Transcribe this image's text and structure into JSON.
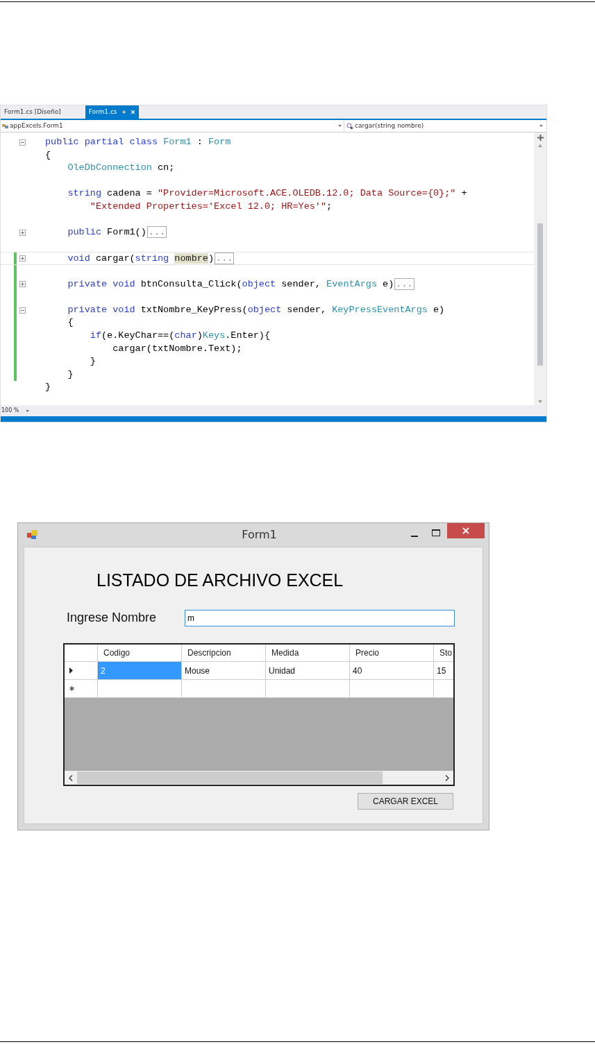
{
  "ide": {
    "tabs": [
      {
        "label": "Form1.cs [Diseño]",
        "selected": false
      },
      {
        "label": "Form1.cs",
        "selected": true
      }
    ],
    "nav": {
      "left": "appExcels.Form1",
      "right": "cargar(string nombre)"
    },
    "lines": [
      {
        "kind": "code",
        "fold": {
          "expanded": true
        },
        "changed": false,
        "current": false,
        "tokens": [
          {
            "text": "public partial class",
            "kind": "keyword"
          },
          {
            "text": " Form1",
            "kind": "type"
          },
          {
            "text": " : ",
            "kind": "plain"
          },
          {
            "text": "Form",
            "kind": "type"
          }
        ]
      },
      {
        "kind": "code",
        "changed": false,
        "current": false,
        "tokens": [
          {
            "text": "{",
            "kind": "plain"
          }
        ],
        "children": [
          {
            "kind": "code",
            "changed": false,
            "current": false,
            "tokens": [
              {
                "text": "OleDbConnection",
                "kind": "type"
              },
              {
                "text": " cn;",
                "kind": "plain"
              }
            ]
          },
          {
            "kind": "blank",
            "changed": false,
            "current": false
          },
          {
            "kind": "code",
            "changed": false,
            "current": false,
            "tokens": [
              {
                "text": "string",
                "kind": "keyword"
              },
              {
                "text": " cadena = ",
                "kind": "plain"
              },
              {
                "text": "\"Provider=Microsoft.ACE.OLEDB.12.0; Data Source={0};\"",
                "kind": "string"
              },
              {
                "text": " +",
                "kind": "plain"
              }
            ],
            "children": [
              {
                "kind": "code",
                "changed": false,
                "current": false,
                "tokens": [
                  {
                    "text": "\"Extended Properties='Excel 12.0; HR=Yes'\"",
                    "kind": "string"
                  },
                  {
                    "text": ";",
                    "kind": "plain"
                  }
                ]
              }
            ]
          },
          {
            "kind": "blank",
            "changed": false,
            "current": false
          },
          {
            "kind": "code",
            "fold": {
              "expanded": false
            },
            "changed": false,
            "current": false,
            "tokens": [
              {
                "text": "public",
                "kind": "keyword"
              },
              {
                "text": " Form1()",
                "kind": "plain"
              },
              {
                "text": "...",
                "kind": "folded"
              }
            ]
          },
          {
            "kind": "blank",
            "changed": false,
            "current": false
          },
          {
            "kind": "code",
            "fold": {
              "expanded": false
            },
            "changed": true,
            "current": true,
            "tokens": [
              {
                "text": "void",
                "kind": "keyword"
              },
              {
                "text": " cargar(",
                "kind": "plain"
              },
              {
                "text": "string ",
                "kind": "keyword"
              },
              {
                "text": "nombre",
                "kind": "highlight"
              },
              {
                "text": ")",
                "kind": "plain"
              },
              {
                "text": "...",
                "kind": "folded"
              }
            ]
          },
          {
            "kind": "blank",
            "changed": true,
            "current": false
          },
          {
            "kind": "code",
            "fold": {
              "expanded": false
            },
            "changed": true,
            "current": false,
            "tokens": [
              {
                "text": "private void",
                "kind": "keyword"
              },
              {
                "text": " btnConsulta_Click(",
                "kind": "plain"
              },
              {
                "text": "object",
                "kind": "keyword"
              },
              {
                "text": " sender, ",
                "kind": "plain"
              },
              {
                "text": "EventArgs",
                "kind": "type"
              },
              {
                "text": " e)",
                "kind": "plain"
              },
              {
                "text": "...",
                "kind": "folded"
              }
            ]
          },
          {
            "kind": "blank",
            "changed": true,
            "current": false
          },
          {
            "kind": "code",
            "fold": {
              "expanded": true
            },
            "changed": true,
            "current": false,
            "tokens": [
              {
                "text": "private void",
                "kind": "keyword"
              },
              {
                "text": " txtNombre_KeyPress(",
                "kind": "plain"
              },
              {
                "text": "object",
                "kind": "keyword"
              },
              {
                "text": " sender, ",
                "kind": "plain"
              },
              {
                "text": "KeyPressEventArgs",
                "kind": "type"
              },
              {
                "text": " e)",
                "kind": "plain"
              }
            ]
          },
          {
            "kind": "code",
            "changed": true,
            "current": false,
            "tokens": [
              {
                "text": "{",
                "kind": "plain"
              }
            ],
            "children": [
              {
                "kind": "code",
                "changed": true,
                "current": false,
                "tokens": [
                  {
                    "text": "if",
                    "kind": "keyword"
                  },
                  {
                    "text": "(e.KeyChar==(",
                    "kind": "plain"
                  },
                  {
                    "text": "char",
                    "kind": "keyword"
                  },
                  {
                    "text": ")",
                    "kind": "plain"
                  },
                  {
                    "text": "Keys",
                    "kind": "type"
                  },
                  {
                    "text": ".Enter){",
                    "kind": "plain"
                  }
                ],
                "children": [
                  {
                    "kind": "code",
                    "changed": true,
                    "current": false,
                    "tokens": [
                      {
                        "text": "cargar(txtNombre.Text);",
                        "kind": "plain"
                      }
                    ]
                  }
                ]
              },
              {
                "kind": "code",
                "changed": true,
                "current": false,
                "tokens": [
                  {
                    "text": "}",
                    "kind": "plain"
                  }
                ]
              }
            ]
          },
          {
            "kind": "code",
            "changed": true,
            "current": false,
            "tokens": [
              {
                "text": "}",
                "kind": "plain"
              }
            ]
          }
        ]
      },
      {
        "kind": "code",
        "changed": false,
        "current": false,
        "tokens": [
          {
            "text": "}",
            "kind": "plain"
          }
        ]
      }
    ],
    "zoom": "100 %"
  },
  "form": {
    "title": "Form1",
    "heading": "LISTADO DE ARCHIVO EXCEL",
    "label": "Ingrese Nombre",
    "input": {
      "value": "m"
    },
    "grid": {
      "columns": [
        "Codigo",
        "Descripcion",
        "Medida",
        "Precio",
        "Sto"
      ],
      "rows": [
        {
          "kind": "data",
          "current": true,
          "cells": [
            {
              "text": "2",
              "selected": true
            },
            {
              "text": "Mouse",
              "selected": false
            },
            {
              "text": "Unidad",
              "selected": false
            },
            {
              "text": "40",
              "selected": false
            },
            {
              "text": "15",
              "selected": false
            }
          ]
        },
        {
          "kind": "new",
          "current": false
        }
      ]
    },
    "button": "CARGAR EXCEL"
  }
}
